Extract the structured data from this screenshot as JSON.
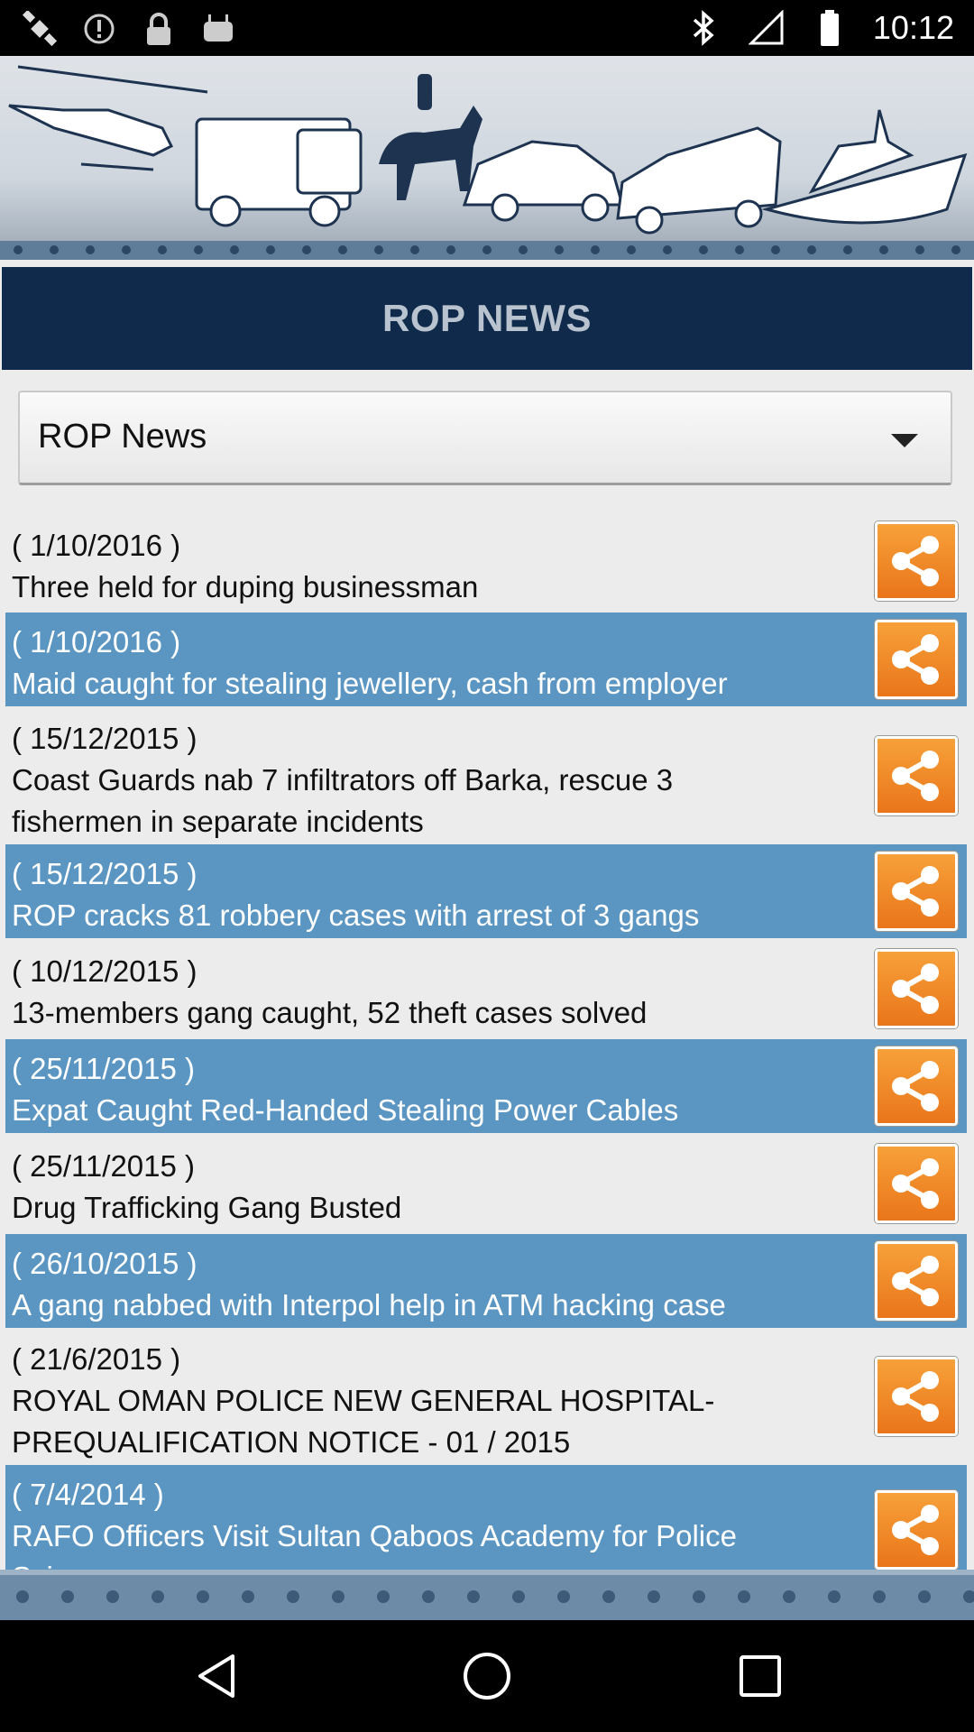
{
  "status_bar": {
    "time": "10:12",
    "left_icons": [
      "satellite-icon",
      "alert-circle-icon",
      "lock-icon",
      "android-icon"
    ],
    "right_icons": [
      "bluetooth-icon",
      "signal-off-icon",
      "battery-icon"
    ]
  },
  "header": {
    "title": "ROP NEWS"
  },
  "category_select": {
    "selected": "ROP News"
  },
  "news": [
    {
      "date": "( 1/10/2016 )",
      "lines": [
        "Three held for duping businessman"
      ]
    },
    {
      "date": "( 1/10/2016 )",
      "lines": [
        "Maid caught for stealing jewellery, cash from employer"
      ]
    },
    {
      "date": "( 15/12/2015 )",
      "lines": [
        "Coast Guards nab 7 infiltrators off Barka, rescue 3",
        "fishermen in separate incidents"
      ]
    },
    {
      "date": "( 15/12/2015 )",
      "lines": [
        "ROP cracks 81 robbery cases with arrest of 3 gangs"
      ]
    },
    {
      "date": "( 10/12/2015 )",
      "lines": [
        "13-members gang caught, 52 theft cases solved"
      ]
    },
    {
      "date": "( 25/11/2015 )",
      "lines": [
        "Expat Caught Red-Handed Stealing Power Cables"
      ]
    },
    {
      "date": "( 25/11/2015 )",
      "lines": [
        "Drug Trafficking Gang Busted"
      ]
    },
    {
      "date": "( 26/10/2015 )",
      "lines": [
        "A gang nabbed with Interpol help in ATM hacking case"
      ]
    },
    {
      "date": "( 21/6/2015 )",
      "lines": [
        "ROYAL OMAN POLICE NEW GENERAL HOSPITAL-",
        "PREQUALIFICATION NOTICE -  01 / 2015"
      ]
    },
    {
      "date": "( 7/4/2014 )",
      "lines": [
        "RAFO Officers Visit Sultan Qaboos Academy for Police",
        "Sciences"
      ]
    }
  ],
  "colors": {
    "header_bg": "#0f2a4a",
    "row_alt_bg": "#5b96c3",
    "share_button": "#f08a25"
  },
  "nav": [
    "back-icon",
    "home-icon",
    "recents-icon"
  ]
}
